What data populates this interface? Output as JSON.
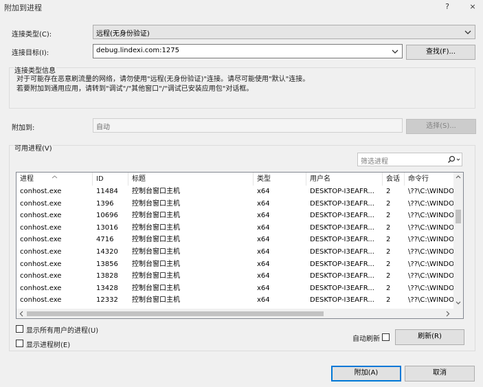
{
  "window": {
    "title": "附加到进程",
    "help_glyph": "?",
    "close_glyph": "×"
  },
  "connection": {
    "type_label": "连接类型(C):",
    "type_value": "远程(无身份验证)",
    "target_label": "连接目标(I):",
    "target_value": "debug.lindexi.com:1275",
    "find_button": "查找(F)..."
  },
  "info": {
    "title": "连接类型信息",
    "line1": "对于可能存在恶意刷流量的网络，请勿使用\"远程(无身份验证)\"连接。请尽可能使用\"默认\"连接。",
    "line2": "若要附加到通用应用，请转到\"调试\"/\"其他窗口\"/\"调试已安装应用包\"对话框。"
  },
  "attach_to": {
    "label": "附加到:",
    "value": "自动",
    "select_button": "选择(S)..."
  },
  "processes": {
    "title": "可用进程(V)",
    "filter_placeholder": "筛选进程",
    "columns": [
      "进程",
      "ID",
      "标题",
      "类型",
      "用户名",
      "会话",
      "命令行"
    ],
    "rows": [
      [
        "conhost.exe",
        "11484",
        "控制台窗口主机",
        "x64",
        "DESKTOP-I3EAFR...",
        "2",
        "\\??\\C:\\WINDO"
      ],
      [
        "conhost.exe",
        "1396",
        "控制台窗口主机",
        "x64",
        "DESKTOP-I3EAFR...",
        "2",
        "\\??\\C:\\WINDO"
      ],
      [
        "conhost.exe",
        "10696",
        "控制台窗口主机",
        "x64",
        "DESKTOP-I3EAFR...",
        "2",
        "\\??\\C:\\WINDO"
      ],
      [
        "conhost.exe",
        "13016",
        "控制台窗口主机",
        "x64",
        "DESKTOP-I3EAFR...",
        "2",
        "\\??\\C:\\WINDO"
      ],
      [
        "conhost.exe",
        "4716",
        "控制台窗口主机",
        "x64",
        "DESKTOP-I3EAFR...",
        "2",
        "\\??\\C:\\WINDO"
      ],
      [
        "conhost.exe",
        "14320",
        "控制台窗口主机",
        "x64",
        "DESKTOP-I3EAFR...",
        "2",
        "\\??\\C:\\WINDO"
      ],
      [
        "conhost.exe",
        "13856",
        "控制台窗口主机",
        "x64",
        "DESKTOP-I3EAFR...",
        "2",
        "\\??\\C:\\WINDO"
      ],
      [
        "conhost.exe",
        "13828",
        "控制台窗口主机",
        "x64",
        "DESKTOP-I3EAFR...",
        "2",
        "\\??\\C:\\WINDO"
      ],
      [
        "conhost.exe",
        "13428",
        "控制台窗口主机",
        "x64",
        "DESKTOP-I3EAFR...",
        "2",
        "\\??\\C:\\WINDO"
      ],
      [
        "conhost.exe",
        "12332",
        "控制台窗口主机",
        "x64",
        "DESKTOP-I3EAFR...",
        "2",
        "\\??\\C:\\WINDO"
      ]
    ],
    "show_all_users": "显示所有用户的进程(U)",
    "show_tree": "显示进程树(E)",
    "auto_refresh": "自动刷新",
    "refresh_button": "刷新(R)"
  },
  "footer": {
    "attach_button": "附加(A)",
    "cancel_button": "取消"
  },
  "colors": {
    "accent": "#0078d7",
    "window_bg": "#f0f0f0"
  }
}
